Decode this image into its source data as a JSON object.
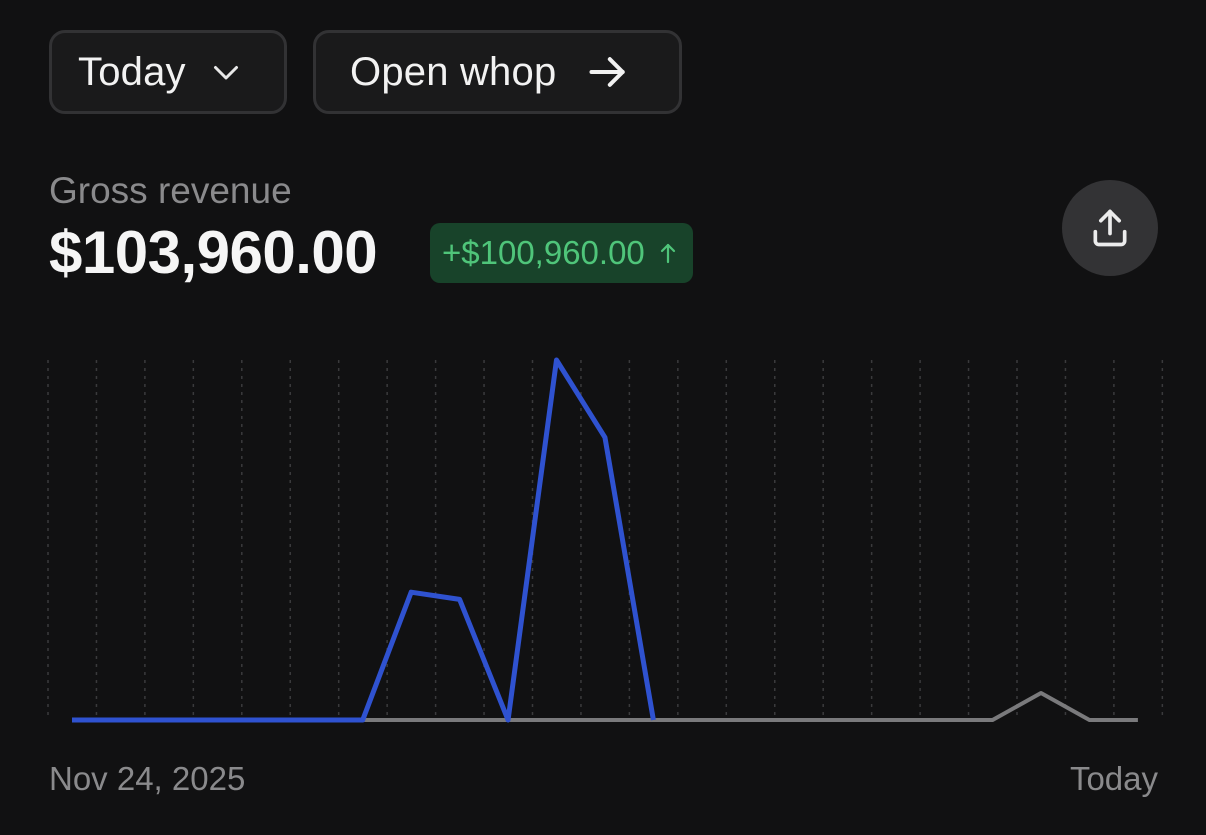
{
  "toolbar": {
    "period_label": "Today",
    "open_label": "Open whop"
  },
  "metric": {
    "label": "Gross revenue",
    "value": "$103,960.00",
    "delta": "+$100,960.00",
    "delta_direction": "up"
  },
  "colors": {
    "background": "#111112",
    "current_series": "#2f52d0",
    "comparison_series": "#7a7a7c",
    "delta_text": "#4fc57a",
    "delta_bg": "#18432a"
  },
  "icons": {
    "period_dropdown": "chevron-down-icon",
    "open": "arrow-right-icon",
    "delta": "arrow-up-icon",
    "share": "share-upload-icon"
  },
  "chart_data": {
    "type": "line",
    "x_labels": [
      "Nov 24, 2025",
      "Today"
    ],
    "grid": "vertical dotted lines",
    "legend": "none",
    "x": [
      0,
      1,
      2,
      3,
      4,
      5,
      6,
      7,
      8,
      9,
      10,
      11,
      12,
      13,
      14,
      15,
      16,
      17,
      18,
      19,
      20,
      21,
      22
    ],
    "ylim": [
      0,
      100
    ],
    "series": [
      {
        "role": "current",
        "color": "#2f52d0",
        "values": [
          0,
          0,
          0,
          0,
          0,
          0,
          0,
          35.5,
          33.5,
          0,
          100,
          78.5,
          0
        ]
      },
      {
        "role": "comparison",
        "color": "#7a7a7c",
        "values": [
          0,
          0,
          0,
          0,
          0,
          0,
          0,
          0,
          0,
          0,
          0,
          0,
          0,
          0,
          0,
          0,
          0,
          0,
          0,
          0,
          7.5,
          0,
          0
        ]
      }
    ]
  }
}
